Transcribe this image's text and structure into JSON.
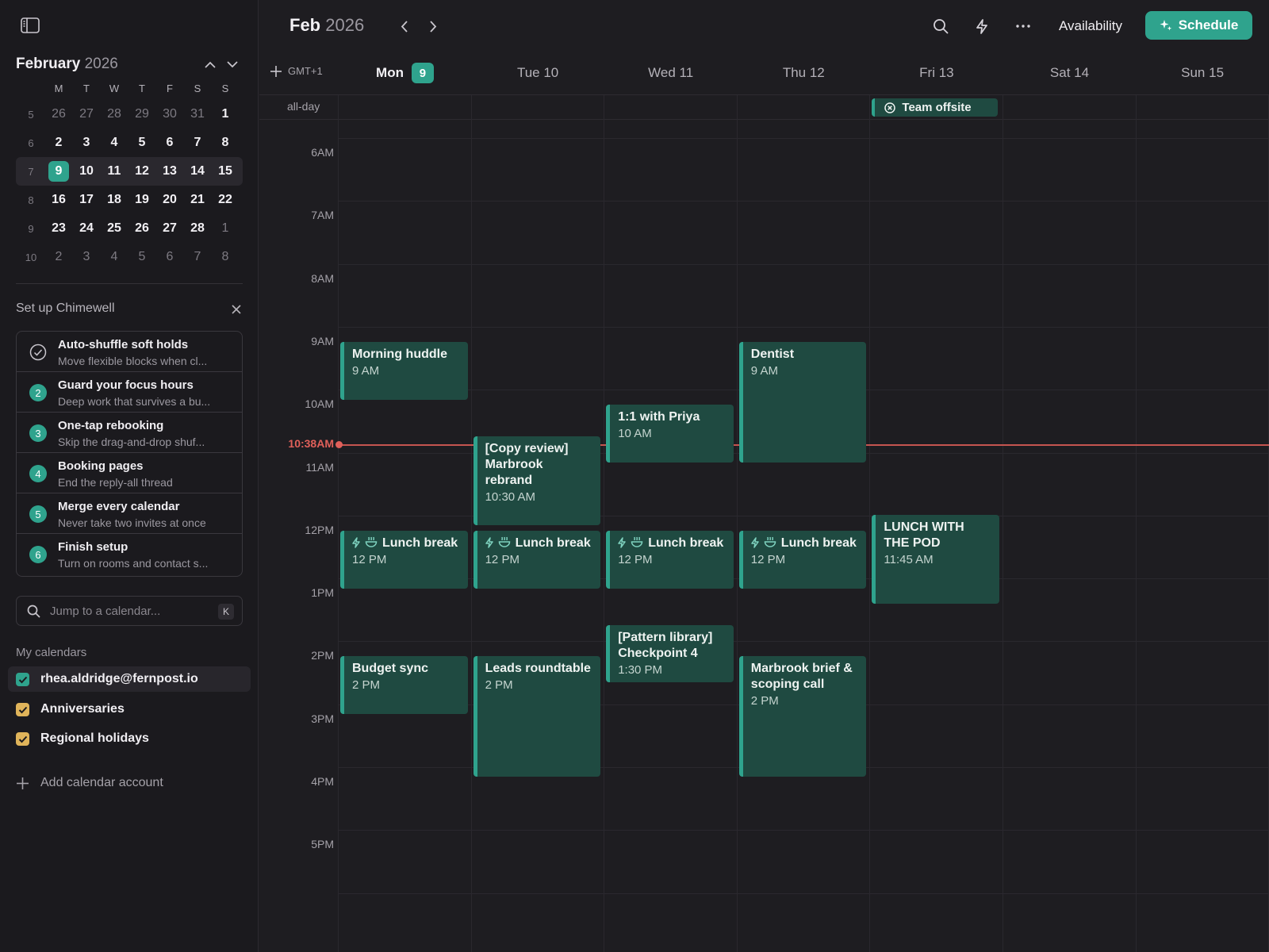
{
  "sidebar": {
    "mini_calendar": {
      "month": "February",
      "year": "2026",
      "weekday_headers": [
        "M",
        "T",
        "W",
        "T",
        "F",
        "S",
        "S"
      ],
      "weeks": [
        {
          "week": "5",
          "days": [
            {
              "d": "26",
              "m": true
            },
            {
              "d": "27",
              "m": true
            },
            {
              "d": "28",
              "m": true
            },
            {
              "d": "29",
              "m": true
            },
            {
              "d": "30",
              "m": true
            },
            {
              "d": "31",
              "m": true
            },
            {
              "d": "1"
            }
          ]
        },
        {
          "week": "6",
          "days": [
            {
              "d": "2"
            },
            {
              "d": "3"
            },
            {
              "d": "4"
            },
            {
              "d": "5"
            },
            {
              "d": "6"
            },
            {
              "d": "7"
            },
            {
              "d": "8"
            }
          ]
        },
        {
          "week": "7",
          "current": true,
          "days": [
            {
              "d": "9",
              "today": true
            },
            {
              "d": "10"
            },
            {
              "d": "11"
            },
            {
              "d": "12"
            },
            {
              "d": "13"
            },
            {
              "d": "14"
            },
            {
              "d": "15"
            }
          ]
        },
        {
          "week": "8",
          "days": [
            {
              "d": "16"
            },
            {
              "d": "17"
            },
            {
              "d": "18"
            },
            {
              "d": "19"
            },
            {
              "d": "20"
            },
            {
              "d": "21"
            },
            {
              "d": "22"
            }
          ]
        },
        {
          "week": "9",
          "days": [
            {
              "d": "23"
            },
            {
              "d": "24"
            },
            {
              "d": "25"
            },
            {
              "d": "26"
            },
            {
              "d": "27"
            },
            {
              "d": "28"
            },
            {
              "d": "1",
              "m": true
            }
          ]
        },
        {
          "week": "10",
          "days": [
            {
              "d": "2",
              "m": true
            },
            {
              "d": "3",
              "m": true
            },
            {
              "d": "4",
              "m": true
            },
            {
              "d": "5",
              "m": true
            },
            {
              "d": "6",
              "m": true
            },
            {
              "d": "7",
              "m": true
            },
            {
              "d": "8",
              "m": true
            }
          ]
        }
      ]
    },
    "setup": {
      "title": "Set up Chimewell",
      "items": [
        {
          "done": true,
          "title": "Auto-shuffle soft holds",
          "subtitle": "Move flexible blocks when cl..."
        },
        {
          "num": "2",
          "title": "Guard your focus hours",
          "subtitle": "Deep work that survives a bu..."
        },
        {
          "num": "3",
          "title": "One-tap rebooking",
          "subtitle": "Skip the drag-and-drop shuf..."
        },
        {
          "num": "4",
          "title": "Booking pages",
          "subtitle": "End the reply-all thread"
        },
        {
          "num": "5",
          "title": "Merge every calendar",
          "subtitle": "Never take two invites at once"
        },
        {
          "num": "6",
          "title": "Finish setup",
          "subtitle": "Turn on rooms and contact s..."
        }
      ]
    },
    "search": {
      "placeholder": "Jump to a calendar...",
      "shortcut": "K"
    },
    "my_calendars": {
      "title": "My calendars",
      "items": [
        {
          "label": "rhea.aldridge@fernpost.io",
          "color": "#2fa38d",
          "checked": true
        },
        {
          "label": "Anniversaries",
          "color": "#e0b45a",
          "checked": true
        },
        {
          "label": "Regional holidays",
          "color": "#e0b45a",
          "checked": true
        }
      ]
    },
    "add_account": "Add calendar account"
  },
  "header": {
    "month": "Feb",
    "year": "2026",
    "availability": "Availability",
    "schedule": "Schedule"
  },
  "week": {
    "timezone": "GMT+1",
    "days": [
      {
        "label": "Mon",
        "badge": "9",
        "today": true
      },
      {
        "label": "Tue 10"
      },
      {
        "label": "Wed 11"
      },
      {
        "label": "Thu 12"
      },
      {
        "label": "Fri 13"
      },
      {
        "label": "Sat 14"
      },
      {
        "label": "Sun 15"
      }
    ],
    "allday_label": "all-day",
    "allday_events": [
      {
        "day": 4,
        "title": "Team offsite"
      }
    ],
    "hours": [
      "6AM",
      "7AM",
      "8AM",
      "9AM",
      "10AM",
      "11AM",
      "12PM",
      "1PM",
      "2PM",
      "3PM",
      "4PM",
      "5PM"
    ],
    "first_hour": 6,
    "now": {
      "label": "10:38AM",
      "hour": 10.633
    },
    "events": [
      {
        "day": 0,
        "title": "Morning huddle",
        "time": "9 AM",
        "start": 9,
        "end": 9.917
      },
      {
        "day": 3,
        "title": "Dentist",
        "time": "9 AM",
        "start": 9,
        "end": 10.917
      },
      {
        "day": 2,
        "title": "1:1 with Priya",
        "time": "10 AM",
        "start": 10,
        "end": 10.917
      },
      {
        "day": 1,
        "title": "[Copy review] Marbrook rebrand",
        "time": "10:30 AM",
        "start": 10.5,
        "end": 11.917
      },
      {
        "day": 0,
        "title": "Lunch break",
        "time": "12 PM",
        "start": 12,
        "end": 12.917,
        "icons": true
      },
      {
        "day": 1,
        "title": "Lunch break",
        "time": "12 PM",
        "start": 12,
        "end": 12.917,
        "icons": true
      },
      {
        "day": 2,
        "title": "Lunch break",
        "time": "12 PM",
        "start": 12,
        "end": 12.917,
        "icons": true
      },
      {
        "day": 3,
        "title": "Lunch break",
        "time": "12 PM",
        "start": 12,
        "end": 12.917,
        "icons": true
      },
      {
        "day": 4,
        "title": "LUNCH WITH THE POD",
        "time": "11:45 AM",
        "start": 11.75,
        "end": 13.167
      },
      {
        "day": 2,
        "title": "[Pattern library] Checkpoint 4",
        "time": "1:30 PM",
        "start": 13.5,
        "end": 14.417
      },
      {
        "day": 0,
        "title": "Budget sync",
        "time": "2 PM",
        "start": 14,
        "end": 14.917
      },
      {
        "day": 1,
        "title": "Leads roundtable",
        "time": "2 PM",
        "start": 14,
        "end": 15.917
      },
      {
        "day": 3,
        "title": "Marbrook brief & scoping call",
        "time": "2 PM",
        "start": 14,
        "end": 15.917
      }
    ]
  }
}
